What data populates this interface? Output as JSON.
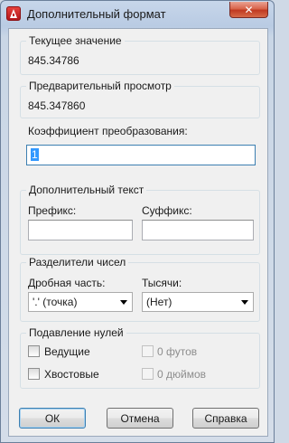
{
  "window": {
    "title": "Дополнительный формат",
    "close_glyph": "✕",
    "app_icon": "autocad-logo-icon"
  },
  "current_value": {
    "title": "Текущее значение",
    "value": "845.34786"
  },
  "preview": {
    "title": "Предварительный просмотр",
    "value": "845.347860"
  },
  "conversion": {
    "title": "Коэффициент преобразования:",
    "value": "1"
  },
  "additional_text": {
    "title": "Дополнительный текст",
    "prefix_label": "Префикс:",
    "prefix_value": "",
    "suffix_label": "Суффикс:",
    "suffix_value": ""
  },
  "separators": {
    "title": "Разделители чисел",
    "fraction_label": "Дробная часть:",
    "fraction_value": "'.' (точка)",
    "thousands_label": "Тысячи:",
    "thousands_value": "(Нет)"
  },
  "zero_suppression": {
    "title": "Подавление нулей",
    "leading_label": "Ведущие",
    "leading_checked": false,
    "trailing_label": "Хвостовые",
    "trailing_checked": false,
    "feet_label": "0 футов",
    "feet_enabled": false,
    "inches_label": "0 дюймов",
    "inches_enabled": false
  },
  "buttons": {
    "ok": "ОК",
    "cancel": "Отмена",
    "help": "Справка"
  }
}
